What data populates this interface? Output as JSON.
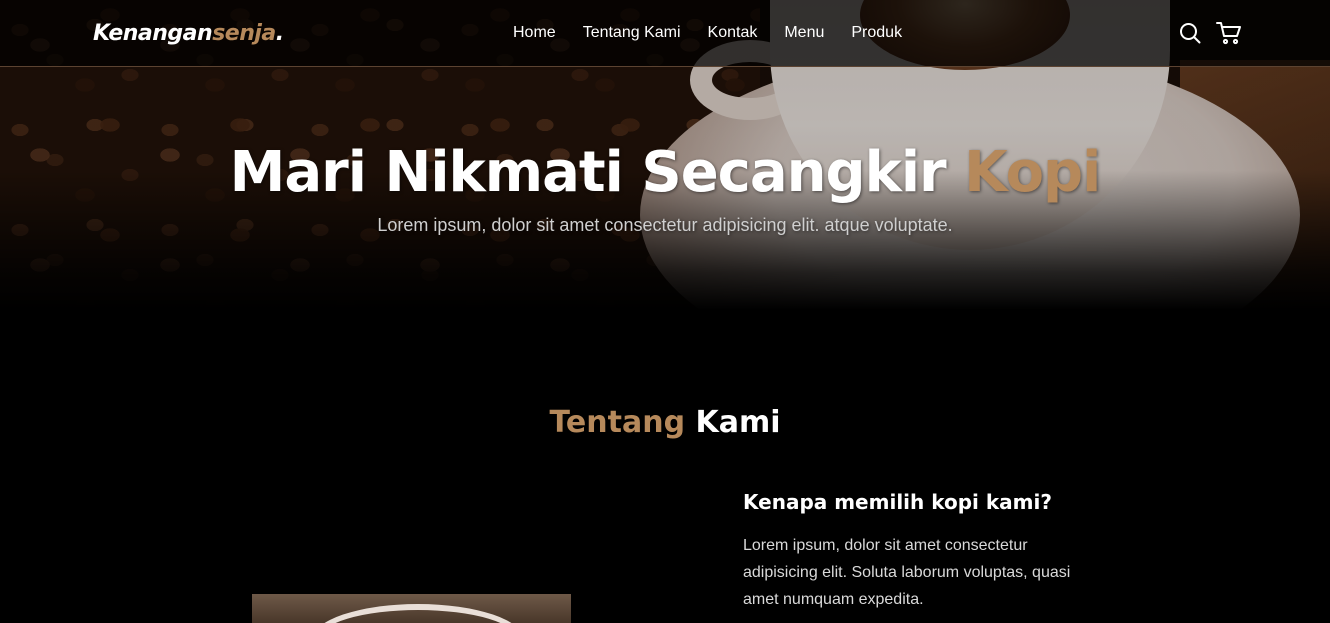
{
  "brand": {
    "name_main": "Kenangan",
    "name_accent": "senja",
    "name_dot": "."
  },
  "nav": {
    "items": [
      {
        "label": "Home"
      },
      {
        "label": "Tentang Kami"
      },
      {
        "label": "Kontak"
      },
      {
        "label": "Menu"
      },
      {
        "label": "Produk"
      }
    ],
    "icons": [
      "search-icon",
      "cart-icon"
    ]
  },
  "hero": {
    "title_main": "Mari Nikmati Secangkir ",
    "title_accent": "Kopi",
    "subtitle": "Lorem ipsum, dolor sit amet consectetur adipisicing elit. atque voluptate."
  },
  "about": {
    "title_accent": "Tentang",
    "title_main": " Kami",
    "heading": "Kenapa memilih kopi kami?",
    "paragraph": "Lorem ipsum, dolor sit amet consectetur adipisicing elit. Soluta laborum voluptas, quasi amet numquam expedita."
  },
  "colors": {
    "accent": "#b6895b",
    "background": "#000000",
    "text": "#ffffff"
  }
}
